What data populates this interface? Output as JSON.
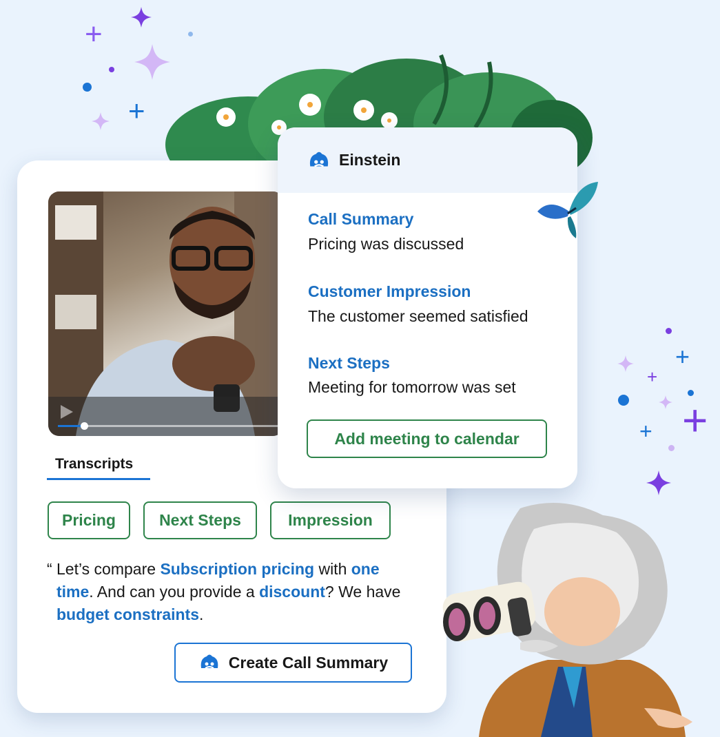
{
  "einstein_panel": {
    "title": "Einstein",
    "sections": [
      {
        "title": "Call Summary",
        "text": "Pricing was discussed"
      },
      {
        "title": "Customer Impression",
        "text": "The customer seemed satisfied"
      },
      {
        "title": "Next Steps",
        "text": "Meeting for tomorrow was set"
      }
    ],
    "add_button": "Add meeting to calendar"
  },
  "call_panel": {
    "tab": "Transcripts",
    "chips": [
      "Pricing",
      "Next Steps",
      "Impression"
    ],
    "transcript": {
      "open_quote": "“",
      "parts": [
        {
          "text": "Let’s compare ",
          "hl": false
        },
        {
          "text": "Subscription pricing",
          "hl": true
        },
        {
          "text": " with ",
          "hl": false
        },
        {
          "text": "one time",
          "hl": true
        },
        {
          "text": ". And can you provide a ",
          "hl": false
        },
        {
          "text": "discount",
          "hl": true
        },
        {
          "text": "? We have ",
          "hl": false
        },
        {
          "text": "budget constraints",
          "hl": true
        },
        {
          "text": ".",
          "hl": false
        }
      ]
    },
    "create_button": "Create Call Summary",
    "video_progress": 0.12
  },
  "icons": [
    "einstein-icon",
    "play-icon",
    "butterfly-icon",
    "sparkle-icon"
  ],
  "colors": {
    "accent_blue": "#1b74d4",
    "link_blue": "#1b6fc2",
    "green": "#2e844a",
    "background": "#eaf3fd"
  }
}
